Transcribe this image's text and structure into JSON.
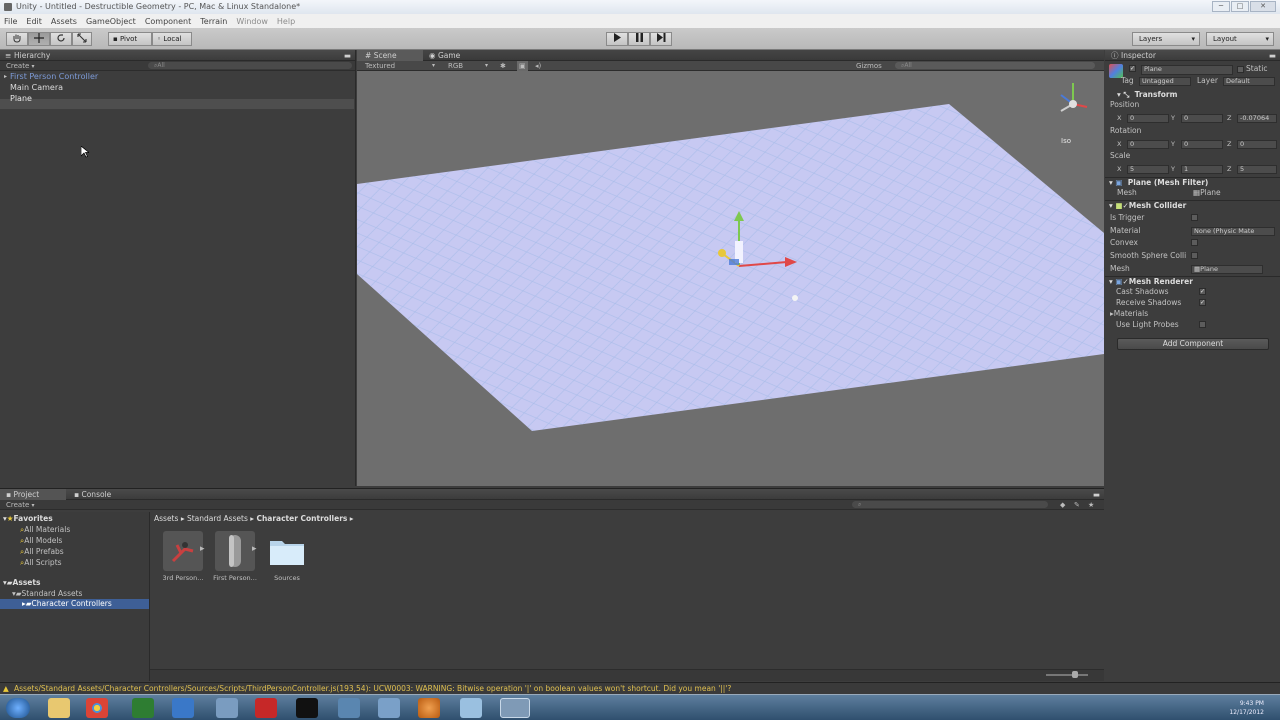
{
  "window": {
    "title": "Unity - Untitled - Destructible Geometry - PC, Mac & Linux Standalone*",
    "buttons": [
      "─",
      "□",
      "✕"
    ]
  },
  "menu": [
    "File",
    "Edit",
    "Assets",
    "GameObject",
    "Component",
    "Terrain",
    "Window",
    "Help"
  ],
  "toolbar": {
    "pivot": "Pivot",
    "local": "Local",
    "layers": "Layers",
    "layout": "Layout"
  },
  "hierarchy": {
    "tab": "Hierarchy",
    "create": "Create",
    "search": "All",
    "items": [
      "First Person Controller",
      "Main Camera",
      "Plane"
    ]
  },
  "scene": {
    "tab_scene": "Scene",
    "tab_game": "Game",
    "render_mode": "Textured",
    "color_mode": "RGB",
    "gizmos": "Gizmos",
    "search": "All",
    "persp": "Iso"
  },
  "inspector": {
    "tab": "Inspector",
    "object_name": "Plane",
    "static_label": "Static",
    "tag_label": "Tag",
    "tag_value": "Untagged",
    "layer_label": "Layer",
    "layer_value": "Default",
    "transform": {
      "title": "Transform",
      "position": {
        "label": "Position",
        "x": "0",
        "y": "0",
        "z": "-0.07064"
      },
      "rotation": {
        "label": "Rotation",
        "x": "0",
        "y": "0",
        "z": "0"
      },
      "scale": {
        "label": "Scale",
        "x": "5",
        "y": "1",
        "z": "5"
      }
    },
    "mesh_filter": {
      "title": "Plane (Mesh Filter)",
      "mesh_label": "Mesh",
      "mesh_value": "Plane"
    },
    "mesh_collider": {
      "title": "Mesh Collider",
      "is_trigger": "Is Trigger",
      "material": "Material",
      "material_value": "None (Physic Mate",
      "convex": "Convex",
      "smooth": "Smooth Sphere Colli",
      "mesh": "Mesh",
      "mesh_value": "Plane"
    },
    "mesh_renderer": {
      "title": "Mesh Renderer",
      "cast_shadows": "Cast Shadows",
      "receive_shadows": "Receive Shadows",
      "materials": "Materials",
      "light_probes": "Use Light Probes"
    },
    "add_component": "Add Component"
  },
  "project": {
    "tab_project": "Project",
    "tab_console": "Console",
    "create": "Create",
    "favorites": {
      "title": "Favorites",
      "items": [
        "All Materials",
        "All Models",
        "All Prefabs",
        "All Scripts"
      ]
    },
    "assets": {
      "title": "Assets",
      "standard": "Standard Assets",
      "character": "Character Controllers"
    },
    "breadcrumb": [
      "Assets",
      "Standard Assets",
      "Character Controllers"
    ],
    "files": [
      "3rd Person...",
      "First Person...",
      "Sources"
    ]
  },
  "status": "Assets/Standard Assets/Character Controllers/Sources/Scripts/ThirdPersonController.js(193,54): UCW0003: WARNING: Bitwise operation '|' on boolean values won't shortcut. Did you mean '||'?",
  "taskbar": {
    "time": "9:43 PM",
    "date": "12/17/2012"
  },
  "colors": {
    "accent": "#3a72b0",
    "warning": "#e0c050",
    "plane": "#c7c9f2"
  }
}
